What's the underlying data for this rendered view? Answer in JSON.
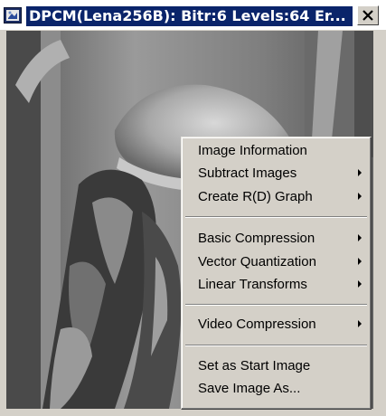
{
  "window": {
    "title": "DPCM(Lena256B): Bitr:6 Levels:64 Er...",
    "app_icon": "application-icon",
    "close_icon": "close-icon"
  },
  "image": {
    "subject": "grayscale photograph"
  },
  "context_menu": {
    "items": [
      {
        "label": "Image Information",
        "submenu": false
      },
      {
        "label": "Subtract Images",
        "submenu": true
      },
      {
        "label": "Create R(D) Graph",
        "submenu": true
      },
      {
        "label": "Basic Compression",
        "submenu": true
      },
      {
        "label": "Vector Quantization",
        "submenu": true
      },
      {
        "label": "Linear Transforms",
        "submenu": true
      },
      {
        "label": "Video Compression",
        "submenu": true
      },
      {
        "label": "Set as Start Image",
        "submenu": false
      },
      {
        "label": "Save Image As...",
        "submenu": false
      }
    ],
    "submenu_icon": "submenu-arrow-icon"
  },
  "colors": {
    "title_bar": "#0a246a",
    "menu_background": "#d4d0c8"
  }
}
